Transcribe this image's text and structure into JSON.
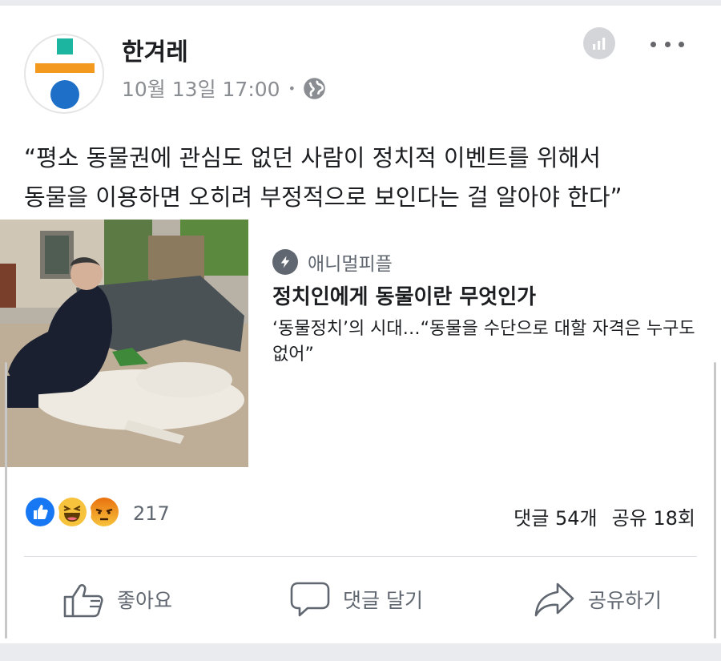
{
  "post": {
    "page_name": "한겨레",
    "time": "10월 13일 17:00",
    "separator": "•",
    "text_line1": "“평소 동물권에 관심도 없던 사람이 정치적 이벤트를 위해서",
    "text_line2": "동물을 이용하면 오히려 부정적으로 보인다는 걸 알아야 한다”"
  },
  "link": {
    "source": "애니멀피플",
    "title": "정치인에게 동물이란 무엇인가",
    "description": "‘동물정치’의 시대…“동물을 수단으로 대할 자격은 누구도 없어”"
  },
  "stats": {
    "reaction_count": "217",
    "comments": "댓글 54개",
    "shares": "공유 18회"
  },
  "actions": {
    "like": "좋아요",
    "comment": "댓글 달기",
    "share": "공유하기"
  },
  "colors": {
    "logo_teal": "#1bb5a0",
    "logo_orange": "#f39a1e",
    "logo_blue": "#1e6fc8",
    "like_blue": "#1877f2",
    "haha_yellow": "#f7c33c",
    "angry_orange": "#e9710f"
  },
  "icons": [
    "insights-icon",
    "more-icon",
    "globe-icon",
    "lightning-icon",
    "like-reaction-icon",
    "haha-reaction-icon",
    "angry-reaction-icon",
    "thumbs-up-icon",
    "comment-icon",
    "share-icon"
  ]
}
